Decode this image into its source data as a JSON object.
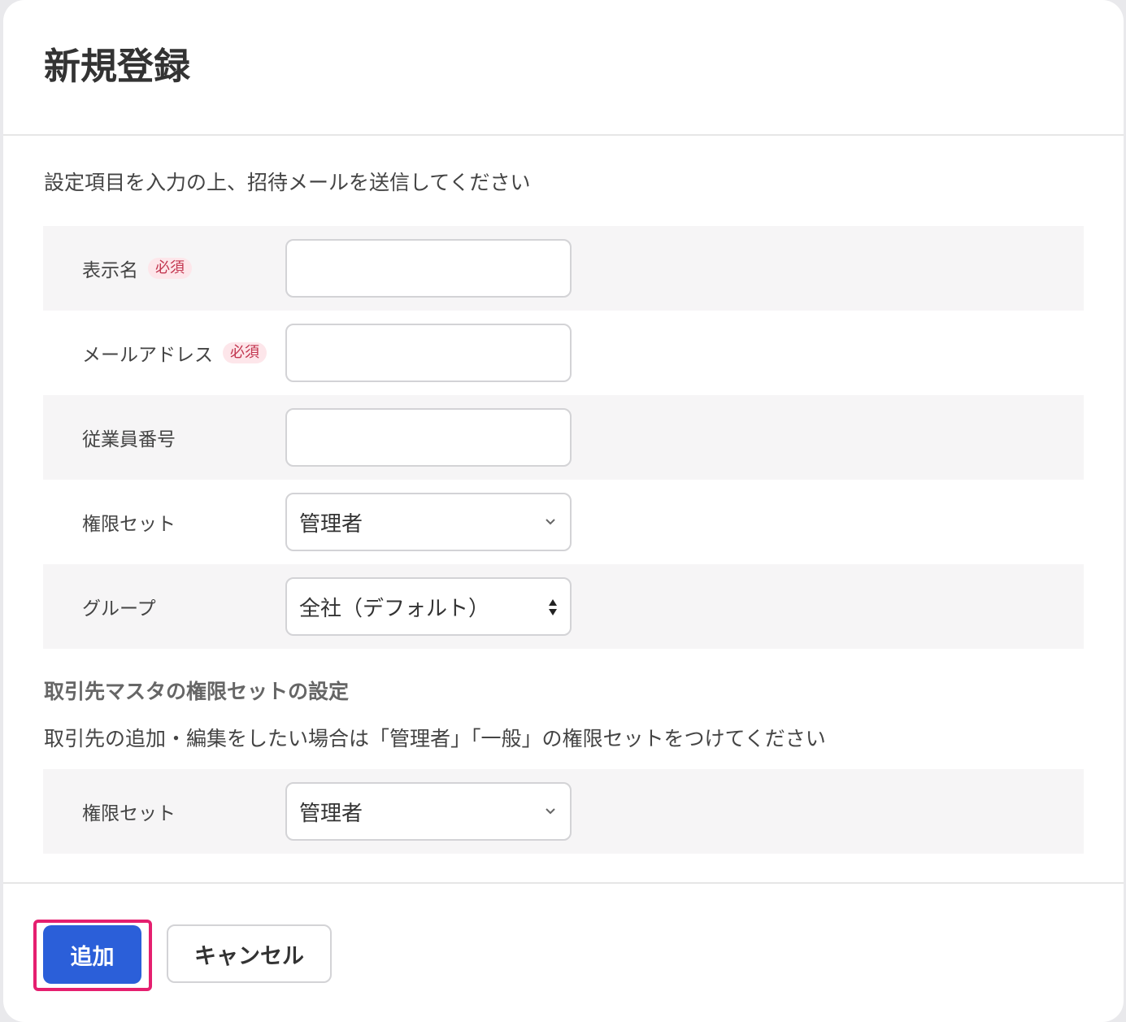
{
  "modal": {
    "title": "新規登録",
    "intro": "設定項目を入力の上、招待メールを送信してください"
  },
  "form": {
    "display_name": {
      "label": "表示名",
      "required_badge": "必須",
      "value": ""
    },
    "email": {
      "label": "メールアドレス",
      "required_badge": "必須",
      "value": ""
    },
    "employee_number": {
      "label": "従業員番号",
      "value": ""
    },
    "permission_set": {
      "label": "権限セット",
      "selected": "管理者"
    },
    "group": {
      "label": "グループ",
      "selected": "全社（デフォルト）"
    }
  },
  "partner_section": {
    "title": "取引先マスタの権限セットの設定",
    "description": "取引先の追加・編集をしたい場合は「管理者」「一般」の権限セットをつけてください",
    "permission_set": {
      "label": "権限セット",
      "selected": "管理者"
    }
  },
  "footer": {
    "add_label": "追加",
    "cancel_label": "キャンセル"
  },
  "colors": {
    "primary": "#2b5fd9",
    "highlight": "#e51f6f",
    "required_bg": "#fde6ea",
    "required_text": "#c2354f",
    "row_shade": "#f6f5f6"
  }
}
